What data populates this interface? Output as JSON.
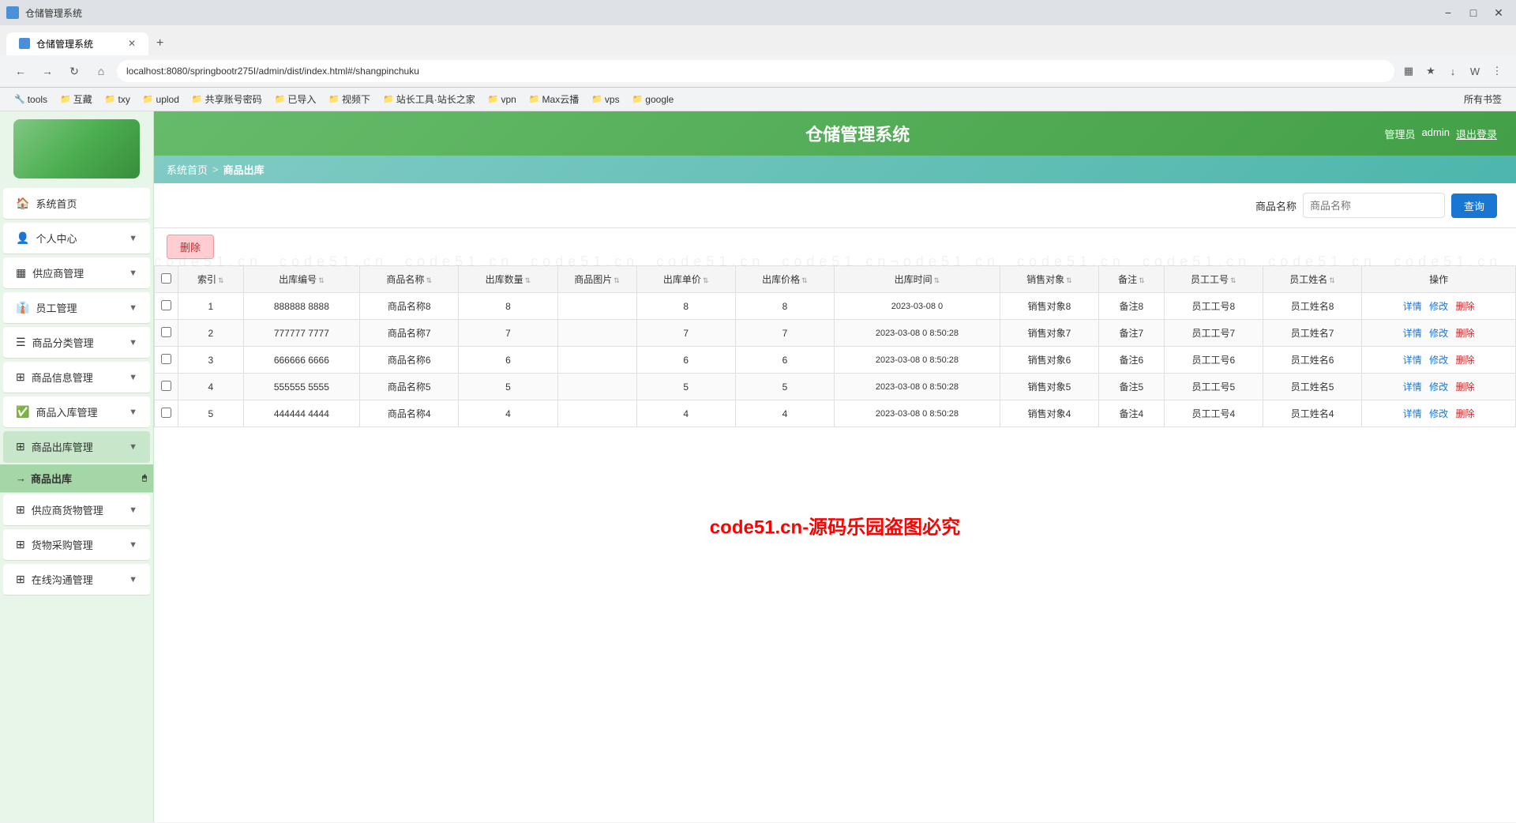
{
  "browser": {
    "tab_title": "仓储管理系统",
    "address": "localhost:8080/springbootr275I/admin/dist/index.html#/shangpinchuku",
    "new_tab_label": "+",
    "bookmarks": [
      {
        "label": "tools",
        "icon": "🔧"
      },
      {
        "label": "互藏",
        "icon": "📁"
      },
      {
        "label": "txy",
        "icon": "📁"
      },
      {
        "label": "uplod",
        "icon": "📁"
      },
      {
        "label": "共享账号密码",
        "icon": "📁"
      },
      {
        "label": "已导入",
        "icon": "📁"
      },
      {
        "label": "视频下",
        "icon": "📁"
      },
      {
        "label": "站长工具·站长之家",
        "icon": "📁"
      },
      {
        "label": "vpn",
        "icon": "📁"
      },
      {
        "label": "Max云播",
        "icon": "📁"
      },
      {
        "label": "vps",
        "icon": "📁"
      },
      {
        "label": "google",
        "icon": "📁"
      },
      {
        "label": "所有书签",
        "icon": "📁"
      }
    ]
  },
  "header": {
    "title": "仓储管理系统",
    "user_prefix": "管理员",
    "username": "admin",
    "logout": "退出登录"
  },
  "breadcrumb": {
    "home": "系统首页",
    "separator": ">",
    "current": "商品出库"
  },
  "search": {
    "label": "商品名称",
    "placeholder": "商品名称",
    "button": "查询"
  },
  "toolbar": {
    "delete_label": "删除"
  },
  "table": {
    "columns": [
      {
        "key": "checkbox",
        "label": ""
      },
      {
        "key": "index",
        "label": "索引"
      },
      {
        "key": "order_no",
        "label": "出库编号"
      },
      {
        "key": "product_name",
        "label": "商品名称"
      },
      {
        "key": "quantity",
        "label": "出库数量"
      },
      {
        "key": "product_img",
        "label": "商品图片"
      },
      {
        "key": "unit_price",
        "label": "出库单价"
      },
      {
        "key": "out_price",
        "label": "出库价格"
      },
      {
        "key": "out_time",
        "label": "出库时间"
      },
      {
        "key": "sale_obj",
        "label": "销售对象"
      },
      {
        "key": "remark",
        "label": "备注"
      },
      {
        "key": "emp_no",
        "label": "员工工号"
      },
      {
        "key": "emp_name",
        "label": "员工姓名"
      },
      {
        "key": "actions",
        "label": "操作"
      }
    ],
    "rows": [
      {
        "index": 1,
        "order_no": "888888 8888",
        "product_name": "商品名称8",
        "quantity": "8",
        "product_img": "",
        "unit_price": "8",
        "out_price": "8",
        "out_time": "2023-03-08 0",
        "sale_obj": "销售对象8",
        "remark": "备注8",
        "emp_no": "员工工号8",
        "emp_name": "员工姓名8",
        "actions": [
          "详情",
          "修改",
          "删除"
        ]
      },
      {
        "index": 2,
        "order_no": "777777 7777",
        "product_name": "商品名称7",
        "quantity": "7",
        "product_img": "",
        "unit_price": "7",
        "out_price": "7",
        "out_time": "2023-03-08 0 8:50:28",
        "sale_obj": "销售对象7",
        "remark": "备注7",
        "emp_no": "员工工号7",
        "emp_name": "员工姓名7",
        "actions": [
          "详情",
          "修改",
          "删除"
        ]
      },
      {
        "index": 3,
        "order_no": "666666 6666",
        "product_name": "商品名称6",
        "quantity": "6",
        "product_img": "",
        "unit_price": "6",
        "out_price": "6",
        "out_time": "2023-03-08 0 8:50:28",
        "sale_obj": "销售对象6",
        "remark": "备注6",
        "emp_no": "员工工号6",
        "emp_name": "员工姓名6",
        "actions": [
          "详情",
          "修改",
          "删除"
        ]
      },
      {
        "index": 4,
        "order_no": "555555 5555",
        "product_name": "商品名称5",
        "quantity": "5",
        "product_img": "",
        "unit_price": "5",
        "out_price": "5",
        "out_time": "2023-03-08 0 8:50:28",
        "sale_obj": "销售对象5",
        "remark": "备注5",
        "emp_no": "员工工号5",
        "emp_name": "员工姓名5",
        "actions": [
          "详情",
          "修改",
          "删除"
        ]
      },
      {
        "index": 5,
        "order_no": "444444 4444",
        "product_name": "商品名称4",
        "quantity": "4",
        "product_img": "",
        "unit_price": "4",
        "out_price": "4",
        "out_time": "2023-03-08 0 8:50:28",
        "sale_obj": "销售对象4",
        "remark": "备注4",
        "emp_no": "员工工号4",
        "emp_name": "员工姓名4",
        "actions": [
          "详情",
          "修改",
          "删除"
        ]
      }
    ]
  },
  "sidebar": {
    "items": [
      {
        "label": "系统首页",
        "icon": "🏠",
        "active": false,
        "has_arrow": false
      },
      {
        "label": "个人中心",
        "icon": "👤",
        "active": false,
        "has_arrow": true
      },
      {
        "label": "供应商管理",
        "icon": "▦",
        "active": false,
        "has_arrow": true
      },
      {
        "label": "员工管理",
        "icon": "👔",
        "active": false,
        "has_arrow": true
      },
      {
        "label": "商品分类管理",
        "icon": "☰",
        "active": false,
        "has_arrow": true
      },
      {
        "label": "商品信息管理",
        "icon": "⊞",
        "active": false,
        "has_arrow": true
      },
      {
        "label": "商品入库管理",
        "icon": "✅",
        "active": false,
        "has_arrow": true
      },
      {
        "label": "商品出库管理",
        "icon": "⊞",
        "active": true,
        "has_arrow": true
      },
      {
        "label": "商品出库",
        "icon": "→",
        "active": true,
        "is_sub": true
      },
      {
        "label": "供应商货物管理",
        "icon": "⊞",
        "active": false,
        "has_arrow": true
      },
      {
        "label": "货物采购管理",
        "icon": "⊞",
        "active": false,
        "has_arrow": true
      },
      {
        "label": "在线沟通管理",
        "icon": "⊞",
        "active": false,
        "has_arrow": true
      }
    ]
  },
  "watermark": {
    "text": "code51.cn-源码乐园盗图必究"
  }
}
